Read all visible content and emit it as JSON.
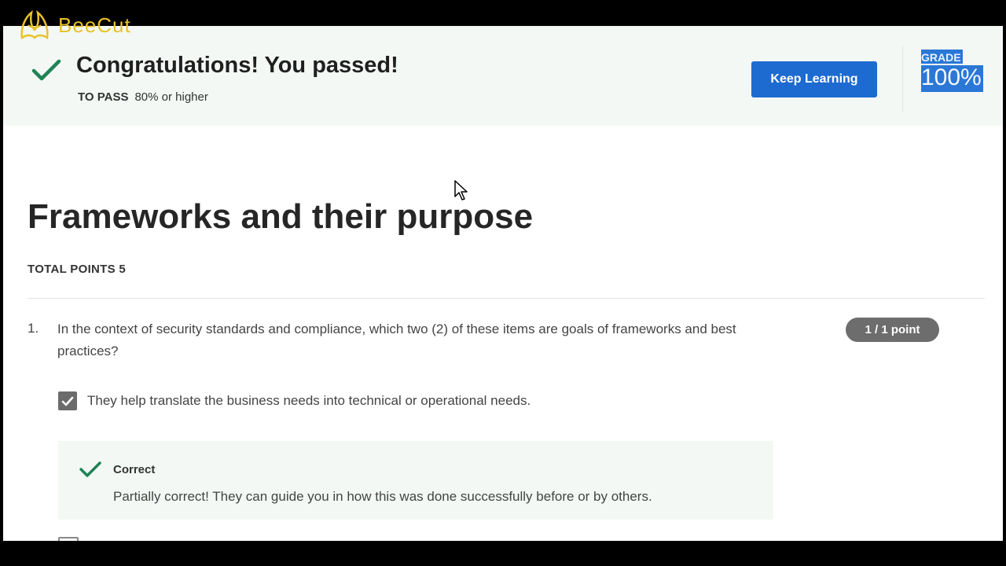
{
  "watermark": {
    "text": "BeeCut"
  },
  "banner": {
    "title": "Congratulations! You passed!",
    "to_pass_label": "TO PASS",
    "to_pass_value": "80% or higher",
    "keep_learning_label": "Keep Learning",
    "grade_label": "GRADE",
    "grade_value": "100%"
  },
  "assignment": {
    "title": "Frameworks and their purpose",
    "total_points": "TOTAL POINTS 5"
  },
  "question": {
    "number": "1.",
    "text": "In the context of security standards and compliance, which two (2) of these items are goals of frameworks and best practices?",
    "points": "1 / 1 point",
    "option_text": "They help translate the business needs into technical or operational needs.",
    "option_checked": true,
    "feedback_label": "Correct",
    "feedback_text": "Partially correct! They can guide you in how this was done successfully before or by others."
  },
  "colors": {
    "accent_blue": "#1d6bd0",
    "success_green": "#1f8354",
    "banner_bg": "#f3f8f5",
    "badge_gray": "#6d6d6d",
    "watermark_gold": "#e9c22a"
  },
  "icons": [
    "bee-logo-icon",
    "checkmark-icon",
    "cursor-icon",
    "checkbox-checked-icon"
  ]
}
